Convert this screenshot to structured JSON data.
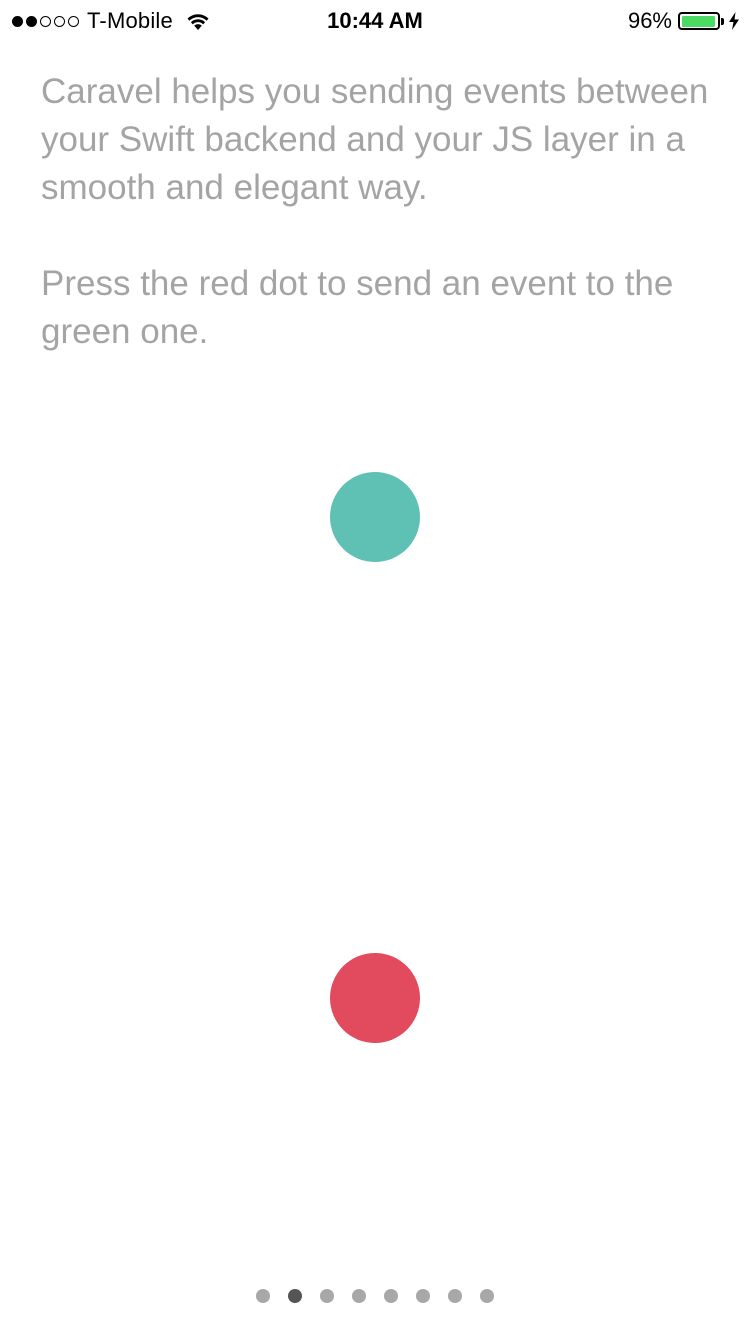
{
  "status_bar": {
    "carrier": "T-Mobile",
    "signal_bars_filled": 2,
    "signal_bars_total": 5,
    "time": "10:44 AM",
    "battery_percent": "96%",
    "battery_level": 0.96,
    "icons": [
      "signal-icon",
      "wifi-icon",
      "battery-icon",
      "charging-bolt-icon"
    ]
  },
  "intro": {
    "paragraph_1": "Caravel helps you sending events between your Swift backend and your JS layer in a smooth and elegant way.",
    "paragraph_2": "Press the red dot to send an event to the green one."
  },
  "dots": {
    "green_color": "#5fc0b4",
    "red_color": "#e24a5d"
  },
  "page_control": {
    "count": 8,
    "current_index": 1,
    "active_color": "#555555",
    "inactive_color": "#a8a8a8"
  },
  "colors": {
    "text_gray": "#a4a4a4",
    "battery_green": "#4cd964"
  }
}
